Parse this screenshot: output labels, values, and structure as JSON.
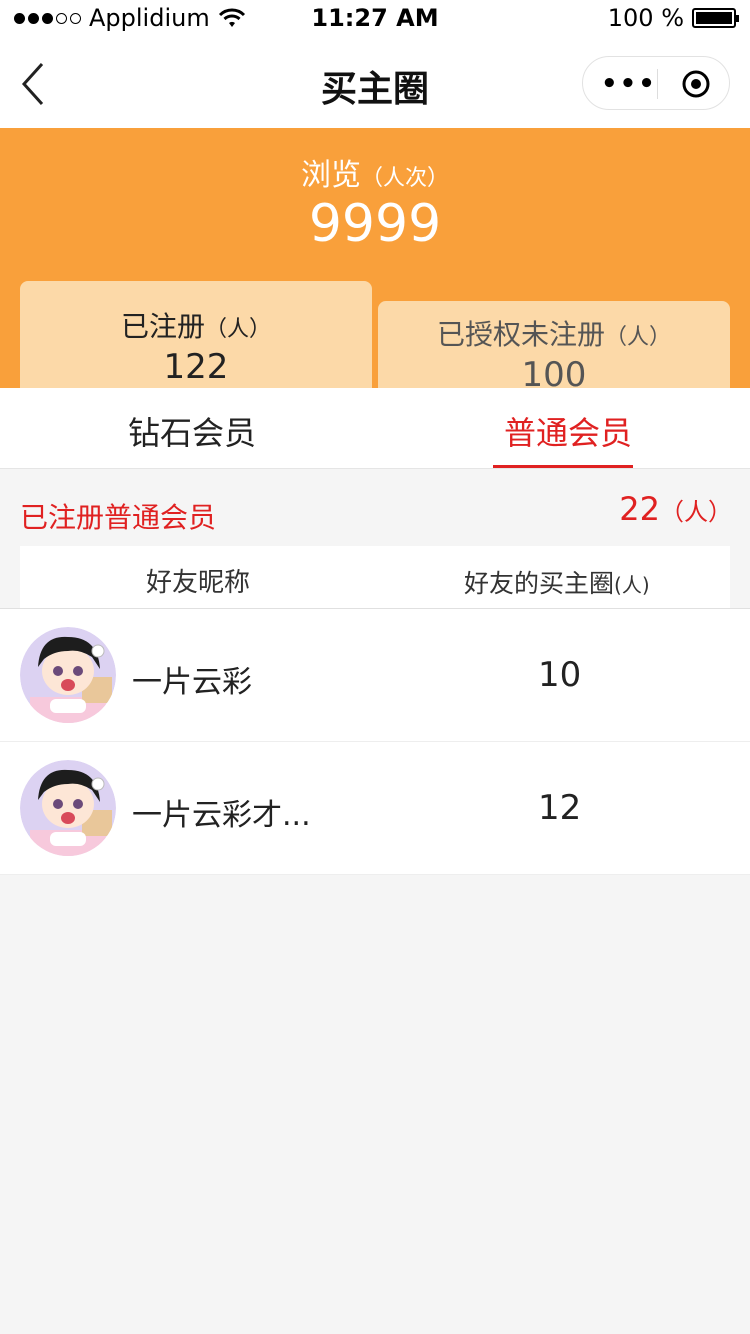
{
  "status_bar": {
    "carrier": "Applidium",
    "time": "11:27 AM",
    "battery": "100 %"
  },
  "nav": {
    "title": "买主圈",
    "more_icon": "ellipsis-icon",
    "target_icon": "target-icon"
  },
  "views": {
    "label": "浏览",
    "unit": "（人次）",
    "count": "9999"
  },
  "registered": {
    "label": "已注册",
    "unit": "（人）",
    "count": "122"
  },
  "authorized_unregistered": {
    "label": "已授权未注册",
    "unit": "（人）",
    "count": "100"
  },
  "tabs": [
    {
      "label": "钻石会员"
    },
    {
      "label": "普通会员"
    }
  ],
  "section": {
    "title": "已注册普通会员",
    "count": "22",
    "unit": "（人）"
  },
  "table": {
    "col1": "好友昵称",
    "col2": "好友的买主圈",
    "col2_unit": "(人)"
  },
  "friends": [
    {
      "name": "一片云彩",
      "count": "10"
    },
    {
      "name": "一片云彩才...",
      "count": "12"
    }
  ],
  "colors": {
    "accent": "#f9a03b",
    "active_tab": "#e02121",
    "card": "#fcd9a8"
  }
}
